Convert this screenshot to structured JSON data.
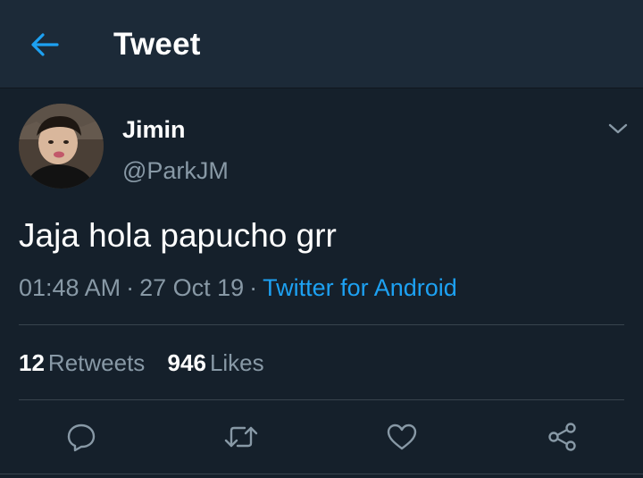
{
  "header": {
    "title": "Tweet",
    "back_icon": "arrow-left-icon"
  },
  "tweet": {
    "author": {
      "display_name": "Jimin",
      "username": "@ParkJM"
    },
    "text": "Jaja hola papucho grr",
    "time": "01:48 AM",
    "date": "27 Oct 19",
    "separator": "·",
    "source": "Twitter for Android",
    "stats": {
      "retweets_count": "12",
      "retweets_label": "Retweets",
      "likes_count": "946",
      "likes_label": "Likes"
    }
  },
  "actions": [
    {
      "icon": "reply-icon"
    },
    {
      "icon": "retweet-icon"
    },
    {
      "icon": "like-icon"
    },
    {
      "icon": "share-icon"
    }
  ],
  "colors": {
    "background": "#15202b",
    "header": "#1c2a38",
    "accent": "#1da1f2",
    "secondary_text": "#8899a6",
    "divider": "#38444d"
  }
}
